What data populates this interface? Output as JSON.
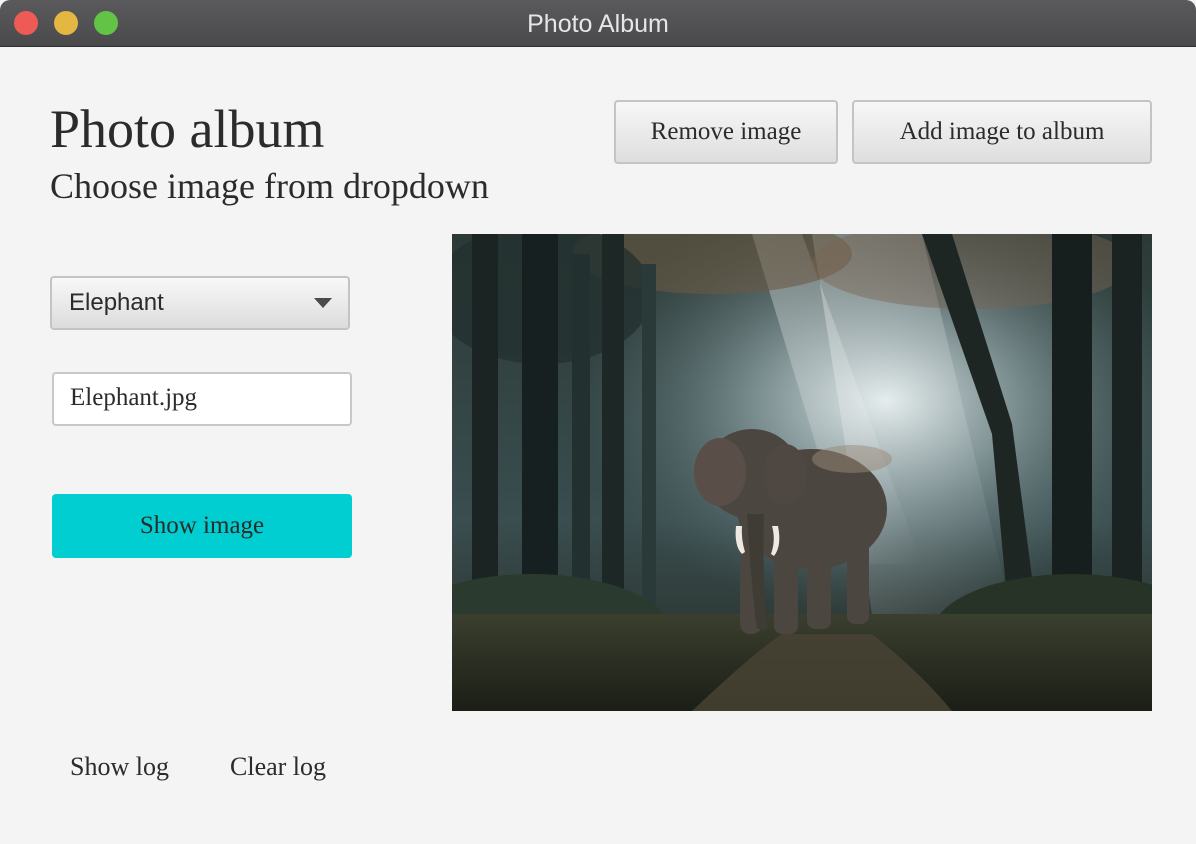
{
  "window": {
    "title": "Photo Album"
  },
  "header": {
    "title": "Photo album",
    "subtitle": "Choose image from dropdown"
  },
  "toolbar": {
    "remove_label": "Remove image",
    "add_label": "Add image to album"
  },
  "dropdown": {
    "selected": "Elephant"
  },
  "filename_field": {
    "value": "Elephant.jpg"
  },
  "show_button": {
    "label": "Show image"
  },
  "image": {
    "subject": "elephant-in-forest-photo"
  },
  "log": {
    "show_label": "Show log",
    "clear_label": "Clear log"
  },
  "colors": {
    "accent": "#00ced1",
    "titlebar": "#535355",
    "background": "#f4f4f4"
  }
}
